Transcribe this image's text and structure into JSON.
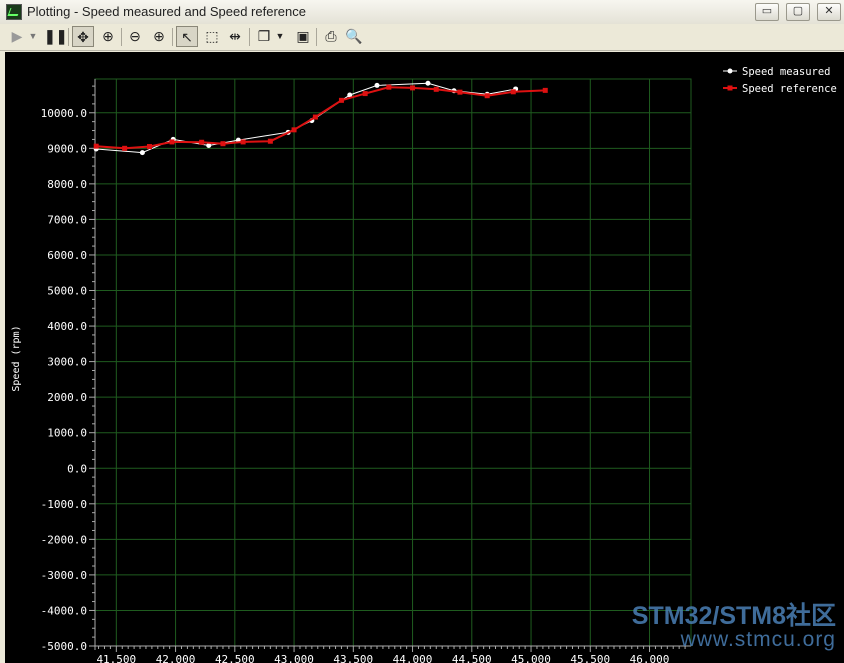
{
  "window": {
    "app": "Plotting",
    "title": "Plotting  - Speed measured and Speed reference",
    "minimize": "▭",
    "maximize": "▢",
    "close": "✕"
  },
  "toolbar": {
    "icons": [
      "play-icon",
      "dropdown-icon",
      "pause-icon",
      "pan-icon",
      "zoom-fit-icon",
      "zoom-out-icon",
      "zoom-in-icon",
      "select-icon",
      "rect-select-icon",
      "split-icon",
      "copy-icon",
      "copy-dropdown-icon",
      "save-icon",
      "print-icon",
      "print-preview-icon"
    ]
  },
  "colors": {
    "background": "#000000",
    "grid": "#1f5c1f",
    "axis": "#aaaaaa",
    "text": "#ffffff",
    "measured": "#ffffff",
    "reference": "#dd1111"
  },
  "chart_data": {
    "type": "line",
    "title": "",
    "xlabel": "",
    "ylabel": "Speed (rpm)",
    "xlim": [
      41.32,
      46.35
    ],
    "ylim": [
      -5000,
      10950
    ],
    "grid": true,
    "legend": "top-right",
    "x_ticks": [
      41.5,
      42.0,
      42.5,
      43.0,
      43.5,
      44.0,
      44.5,
      45.0,
      45.5,
      46.0
    ],
    "x_tick_labels": [
      "41.500",
      "42.000",
      "42.500",
      "43.000",
      "43.500",
      "44.000",
      "44.500",
      "45.000",
      "45.500",
      "46.000"
    ],
    "y_ticks": [
      10000,
      9000,
      8000,
      7000,
      6000,
      5000,
      4000,
      3000,
      2000,
      1000,
      0,
      -1000,
      -2000,
      -3000,
      -4000,
      -5000
    ],
    "y_tick_labels": [
      "10000.0",
      "9000.0",
      "8000.0",
      "7000.0",
      "6000.0",
      "5000.0",
      "4000.0",
      "3000.0",
      "2000.0",
      "1000.0",
      "0.0",
      "-1000.0",
      "-2000.0",
      "-3000.0",
      "-4000.0",
      "-5000.0"
    ],
    "series": [
      {
        "name": "Speed measured",
        "color": "#ffffff",
        "marker": "circle",
        "x": [
          41.33,
          41.72,
          41.98,
          42.28,
          42.53,
          42.95,
          43.15,
          43.47,
          43.7,
          44.13,
          44.35,
          44.63,
          44.87
        ],
        "y": [
          8980,
          8880,
          9250,
          9080,
          9230,
          9450,
          9780,
          10500,
          10770,
          10830,
          10620,
          10520,
          10670
        ]
      },
      {
        "name": "Speed reference",
        "color": "#dd1111",
        "marker": "square",
        "x": [
          41.33,
          41.57,
          41.78,
          41.97,
          42.22,
          42.4,
          42.57,
          42.8,
          43.0,
          43.18,
          43.4,
          43.6,
          43.8,
          44.0,
          44.2,
          44.4,
          44.63,
          44.85,
          45.12
        ],
        "y": [
          9060,
          9000,
          9050,
          9180,
          9170,
          9130,
          9180,
          9200,
          9520,
          9880,
          10350,
          10540,
          10720,
          10700,
          10660,
          10580,
          10480,
          10590,
          10630
        ]
      }
    ]
  },
  "watermark": {
    "line1": "STM32/STM8社区",
    "line2": "www.stmcu.org"
  }
}
